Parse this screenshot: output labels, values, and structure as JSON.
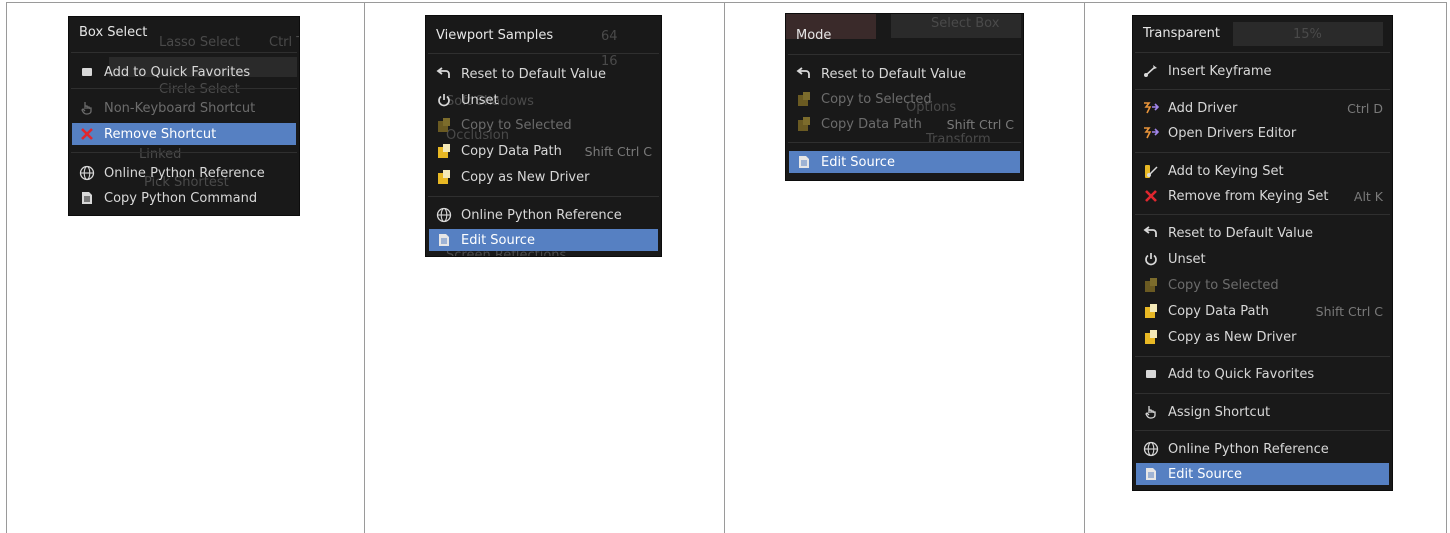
{
  "panels": [
    {
      "title": "Box Select",
      "background_text": [
        "Lasso Select",
        "Ctrl T",
        "Circle Select",
        "Linked",
        "Pick Shortest"
      ],
      "items": [
        {
          "label": "Add to Quick Favorites",
          "icon": "favorites-icon"
        },
        {
          "label": "Non-Keyboard Shortcut",
          "icon": "hand-icon",
          "state": "dim"
        },
        {
          "label": "Remove Shortcut",
          "icon": "remove-x-icon",
          "state": "selected"
        },
        {
          "label": "Online Python Reference",
          "icon": "globe-icon"
        },
        {
          "label": "Copy Python Command",
          "icon": "document-icon"
        }
      ]
    },
    {
      "title": "Viewport Samples",
      "background_text": [
        "64",
        "16",
        "Soft Shadows",
        "Occlusion",
        "Screen Reflections"
      ],
      "items": [
        {
          "label": "Reset to Default Value",
          "icon": "reset-icon"
        },
        {
          "label": "Unset",
          "icon": "power-icon"
        },
        {
          "label": "Copy to Selected",
          "icon": "clipboard-icon",
          "state": "dim"
        },
        {
          "label": "Copy Data Path",
          "icon": "clipboard-icon",
          "shortcut": "Shift Ctrl C"
        },
        {
          "label": "Copy as New Driver",
          "icon": "clipboard-icon"
        },
        {
          "label": "Online Python Reference",
          "icon": "globe-icon"
        },
        {
          "label": "Edit Source",
          "icon": "document-icon",
          "state": "selected"
        }
      ]
    },
    {
      "title": "Mode",
      "background_text": [
        "Select Box",
        "Options",
        "Transform"
      ],
      "items": [
        {
          "label": "Reset to Default Value",
          "icon": "reset-icon"
        },
        {
          "label": "Copy to Selected",
          "icon": "clipboard-icon",
          "state": "dim"
        },
        {
          "label": "Copy Data Path",
          "icon": "clipboard-icon",
          "shortcut": "Shift Ctrl C",
          "state": "dim"
        },
        {
          "label": "Edit Source",
          "icon": "document-icon",
          "state": "selected"
        }
      ]
    },
    {
      "title": "Transparent",
      "background_text": [
        "15%"
      ],
      "items": [
        {
          "label": "Insert Keyframe",
          "icon": "keyframe-icon"
        },
        {
          "label": "Add Driver",
          "icon": "driver-icon",
          "shortcut": "Ctrl D"
        },
        {
          "label": "Open Drivers Editor",
          "icon": "driver-icon"
        },
        {
          "label": "Add to Keying Set",
          "icon": "keying-set-icon"
        },
        {
          "label": "Remove from Keying Set",
          "icon": "remove-x-icon",
          "shortcut": "Alt K"
        },
        {
          "label": "Reset to Default Value",
          "icon": "reset-icon"
        },
        {
          "label": "Unset",
          "icon": "power-icon"
        },
        {
          "label": "Copy to Selected",
          "icon": "clipboard-icon",
          "state": "dim"
        },
        {
          "label": "Copy Data Path",
          "icon": "clipboard-icon",
          "shortcut": "Shift Ctrl C"
        },
        {
          "label": "Copy as New Driver",
          "icon": "clipboard-icon"
        },
        {
          "label": "Add to Quick Favorites",
          "icon": "favorites-icon"
        },
        {
          "label": "Assign Shortcut",
          "icon": "hand-icon"
        },
        {
          "label": "Online Python Reference",
          "icon": "globe-icon"
        },
        {
          "label": "Edit Source",
          "icon": "document-icon",
          "state": "selected"
        }
      ]
    }
  ],
  "colors": {
    "menu_bg": "#191919",
    "highlight": "#5680c2",
    "text": "#d8d8d8",
    "dim_text": "#6c6c6c",
    "remove_red": "#e0272f",
    "clipboard_yellow": "#e8b824"
  }
}
